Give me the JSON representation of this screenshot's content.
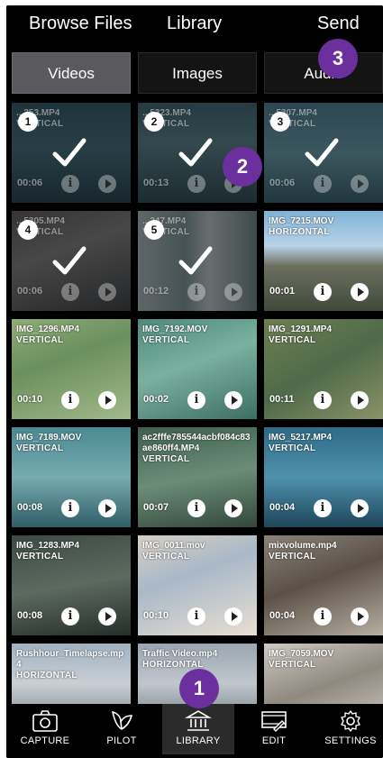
{
  "header": {
    "browse_files": "Browse Files",
    "library": "Library",
    "send": "Send"
  },
  "tabs": [
    {
      "label": "Videos",
      "active": true
    },
    {
      "label": "Images",
      "active": false
    },
    {
      "label": "Audio",
      "active": false
    }
  ],
  "cells": [
    {
      "name": "...353.MP4",
      "orientation": "VERTICAL",
      "duration": "00:06",
      "selected": true,
      "order": "1",
      "palette": "sea1"
    },
    {
      "name": "...5323.MP4",
      "orientation": "VERTICAL",
      "duration": "00:13",
      "selected": true,
      "order": "2",
      "palette": "sea2"
    },
    {
      "name": "...5307.MP4",
      "orientation": "VERTICAL",
      "duration": "00:06",
      "selected": true,
      "order": "3",
      "palette": "sea3"
    },
    {
      "name": "...5305.MP4",
      "orientation": "VERTICAL",
      "duration": "00:06",
      "selected": true,
      "order": "4",
      "palette": "street"
    },
    {
      "name": "...247.MP4",
      "orientation": "VERTICAL",
      "duration": "00:12",
      "selected": true,
      "order": "5",
      "palette": "building"
    },
    {
      "name": "IMG_7215.MOV",
      "orientation": "HORIZONTAL",
      "duration": "00:01",
      "selected": false,
      "palette": "coast"
    },
    {
      "name": "IMG_1296.MP4",
      "orientation": "VERTICAL",
      "duration": "00:10",
      "selected": false,
      "palette": "turtle1"
    },
    {
      "name": "IMG_7192.MOV",
      "orientation": "VERTICAL",
      "duration": "00:02",
      "selected": false,
      "palette": "turtle2"
    },
    {
      "name": "IMG_1291.MP4",
      "orientation": "VERTICAL",
      "duration": "00:11",
      "selected": false,
      "palette": "turtle3"
    },
    {
      "name": "IMG_7189.MOV",
      "orientation": "VERTICAL",
      "duration": "00:08",
      "selected": false,
      "palette": "water1"
    },
    {
      "name": "ac2fffe785544acbf084c83ae860ff4.MP4",
      "orientation": "VERTICAL",
      "duration": "00:07",
      "selected": false,
      "palette": "reef"
    },
    {
      "name": "IMG_5217.MP4",
      "orientation": "VERTICAL",
      "duration": "00:04",
      "selected": false,
      "palette": "water2"
    },
    {
      "name": "IMG_1283.MP4",
      "orientation": "VERTICAL",
      "duration": "00:08",
      "selected": false,
      "palette": "dark"
    },
    {
      "name": "IMG_0011.mov",
      "orientation": "VERTICAL",
      "duration": "00:10",
      "selected": false,
      "palette": "baby"
    },
    {
      "name": "mixvolume.mp4",
      "orientation": "VERTICAL",
      "duration": "00:04",
      "selected": false,
      "palette": "dog"
    },
    {
      "name": "Rushhour_Timelapse.mp4",
      "orientation": "HORIZONTAL",
      "duration": "",
      "selected": false,
      "palette": "city"
    },
    {
      "name": "Traffic Video.mp4",
      "orientation": "HORIZONTAL",
      "duration": "",
      "selected": false,
      "palette": "city2"
    },
    {
      "name": "IMG_7059.MOV",
      "orientation": "VERTICAL",
      "duration": "",
      "selected": false,
      "palette": "dog2"
    }
  ],
  "nav": [
    {
      "label": "CAPTURE",
      "icon": "camera-icon",
      "active": false
    },
    {
      "label": "PILOT",
      "icon": "pilot-icon",
      "active": false
    },
    {
      "label": "LIBRARY",
      "icon": "library-icon",
      "active": true
    },
    {
      "label": "EDIT",
      "icon": "edit-icon",
      "active": false
    },
    {
      "label": "SETTINGS",
      "icon": "gear-icon",
      "active": false
    }
  ],
  "callouts": [
    "1",
    "2",
    "3"
  ],
  "colors": {
    "callout": "#6b2f9e",
    "tab_active": "#5a5a5e",
    "background": "#000000"
  }
}
